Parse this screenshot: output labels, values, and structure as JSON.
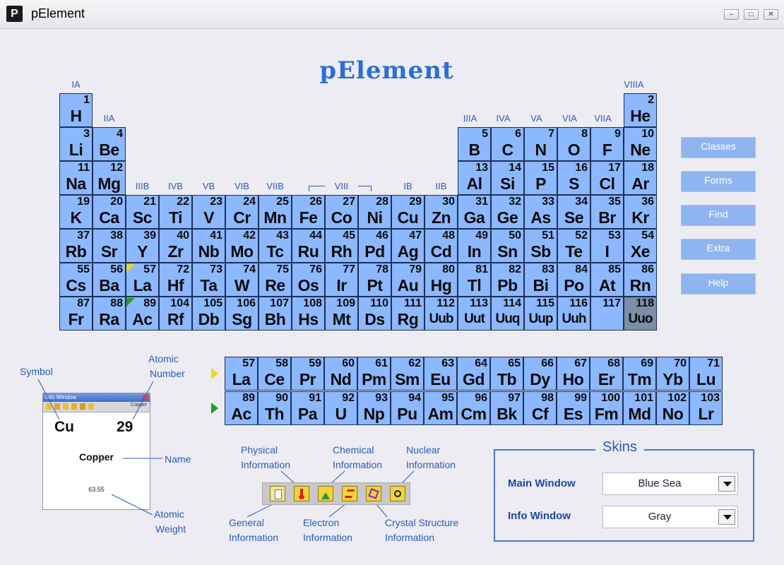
{
  "window": {
    "title": "pElement",
    "app_icon_letter": "P",
    "minimize_glyph": "–",
    "maximize_glyph": "□",
    "close_glyph": "✕"
  },
  "logo": "pElement",
  "group_labels": {
    "IA": "IA",
    "IIA": "IIA",
    "IIIA": "IIIA",
    "IVA": "IVA",
    "VA": "VA",
    "VIA": "VIA",
    "VIIA": "VIIA",
    "VIIIA": "VIIIA",
    "IIIB": "IIIB",
    "IVB": "IVB",
    "VB": "VB",
    "VIB": "VIB",
    "VIIB": "VIIB",
    "VIII": "VIII",
    "IB": "IB",
    "IIB": "IIB"
  },
  "elements": [
    {
      "n": "1",
      "s": "H",
      "r": 1,
      "c": 1
    },
    {
      "n": "2",
      "s": "He",
      "r": 1,
      "c": 18
    },
    {
      "n": "3",
      "s": "Li",
      "r": 2,
      "c": 1
    },
    {
      "n": "4",
      "s": "Be",
      "r": 2,
      "c": 2
    },
    {
      "n": "5",
      "s": "B",
      "r": 2,
      "c": 13
    },
    {
      "n": "6",
      "s": "C",
      "r": 2,
      "c": 14
    },
    {
      "n": "7",
      "s": "N",
      "r": 2,
      "c": 15
    },
    {
      "n": "8",
      "s": "O",
      "r": 2,
      "c": 16
    },
    {
      "n": "9",
      "s": "F",
      "r": 2,
      "c": 17
    },
    {
      "n": "10",
      "s": "Ne",
      "r": 2,
      "c": 18
    },
    {
      "n": "11",
      "s": "Na",
      "r": 3,
      "c": 1
    },
    {
      "n": "12",
      "s": "Mg",
      "r": 3,
      "c": 2
    },
    {
      "n": "13",
      "s": "Al",
      "r": 3,
      "c": 13
    },
    {
      "n": "14",
      "s": "Si",
      "r": 3,
      "c": 14
    },
    {
      "n": "15",
      "s": "P",
      "r": 3,
      "c": 15
    },
    {
      "n": "16",
      "s": "S",
      "r": 3,
      "c": 16
    },
    {
      "n": "17",
      "s": "Cl",
      "r": 3,
      "c": 17
    },
    {
      "n": "18",
      "s": "Ar",
      "r": 3,
      "c": 18
    },
    {
      "n": "19",
      "s": "K",
      "r": 4,
      "c": 1
    },
    {
      "n": "20",
      "s": "Ca",
      "r": 4,
      "c": 2
    },
    {
      "n": "21",
      "s": "Sc",
      "r": 4,
      "c": 3
    },
    {
      "n": "22",
      "s": "Ti",
      "r": 4,
      "c": 4
    },
    {
      "n": "23",
      "s": "V",
      "r": 4,
      "c": 5
    },
    {
      "n": "24",
      "s": "Cr",
      "r": 4,
      "c": 6
    },
    {
      "n": "25",
      "s": "Mn",
      "r": 4,
      "c": 7
    },
    {
      "n": "26",
      "s": "Fe",
      "r": 4,
      "c": 8
    },
    {
      "n": "27",
      "s": "Co",
      "r": 4,
      "c": 9
    },
    {
      "n": "28",
      "s": "Ni",
      "r": 4,
      "c": 10
    },
    {
      "n": "29",
      "s": "Cu",
      "r": 4,
      "c": 11
    },
    {
      "n": "30",
      "s": "Zn",
      "r": 4,
      "c": 12
    },
    {
      "n": "31",
      "s": "Ga",
      "r": 4,
      "c": 13
    },
    {
      "n": "32",
      "s": "Ge",
      "r": 4,
      "c": 14
    },
    {
      "n": "33",
      "s": "As",
      "r": 4,
      "c": 15
    },
    {
      "n": "34",
      "s": "Se",
      "r": 4,
      "c": 16
    },
    {
      "n": "35",
      "s": "Br",
      "r": 4,
      "c": 17
    },
    {
      "n": "36",
      "s": "Kr",
      "r": 4,
      "c": 18
    },
    {
      "n": "37",
      "s": "Rb",
      "r": 5,
      "c": 1
    },
    {
      "n": "38",
      "s": "Sr",
      "r": 5,
      "c": 2
    },
    {
      "n": "39",
      "s": "Y",
      "r": 5,
      "c": 3
    },
    {
      "n": "40",
      "s": "Zr",
      "r": 5,
      "c": 4
    },
    {
      "n": "41",
      "s": "Nb",
      "r": 5,
      "c": 5
    },
    {
      "n": "42",
      "s": "Mo",
      "r": 5,
      "c": 6
    },
    {
      "n": "43",
      "s": "Tc",
      "r": 5,
      "c": 7
    },
    {
      "n": "44",
      "s": "Ru",
      "r": 5,
      "c": 8
    },
    {
      "n": "45",
      "s": "Rh",
      "r": 5,
      "c": 9
    },
    {
      "n": "46",
      "s": "Pd",
      "r": 5,
      "c": 10
    },
    {
      "n": "47",
      "s": "Ag",
      "r": 5,
      "c": 11
    },
    {
      "n": "48",
      "s": "Cd",
      "r": 5,
      "c": 12
    },
    {
      "n": "49",
      "s": "In",
      "r": 5,
      "c": 13
    },
    {
      "n": "50",
      "s": "Sn",
      "r": 5,
      "c": 14
    },
    {
      "n": "51",
      "s": "Sb",
      "r": 5,
      "c": 15
    },
    {
      "n": "52",
      "s": "Te",
      "r": 5,
      "c": 16
    },
    {
      "n": "53",
      "s": "I",
      "r": 5,
      "c": 17
    },
    {
      "n": "54",
      "s": "Xe",
      "r": 5,
      "c": 18
    },
    {
      "n": "55",
      "s": "Cs",
      "r": 6,
      "c": 1
    },
    {
      "n": "56",
      "s": "Ba",
      "r": 6,
      "c": 2
    },
    {
      "n": "57",
      "s": "La",
      "r": 6,
      "c": 3
    },
    {
      "n": "72",
      "s": "Hf",
      "r": 6,
      "c": 4
    },
    {
      "n": "73",
      "s": "Ta",
      "r": 6,
      "c": 5
    },
    {
      "n": "74",
      "s": "W",
      "r": 6,
      "c": 6
    },
    {
      "n": "75",
      "s": "Re",
      "r": 6,
      "c": 7
    },
    {
      "n": "76",
      "s": "Os",
      "r": 6,
      "c": 8
    },
    {
      "n": "77",
      "s": "Ir",
      "r": 6,
      "c": 9
    },
    {
      "n": "78",
      "s": "Pt",
      "r": 6,
      "c": 10
    },
    {
      "n": "79",
      "s": "Au",
      "r": 6,
      "c": 11
    },
    {
      "n": "80",
      "s": "Hg",
      "r": 6,
      "c": 12
    },
    {
      "n": "81",
      "s": "Tl",
      "r": 6,
      "c": 13
    },
    {
      "n": "82",
      "s": "Pb",
      "r": 6,
      "c": 14
    },
    {
      "n": "83",
      "s": "Bi",
      "r": 6,
      "c": 15
    },
    {
      "n": "84",
      "s": "Po",
      "r": 6,
      "c": 16
    },
    {
      "n": "85",
      "s": "At",
      "r": 6,
      "c": 17
    },
    {
      "n": "86",
      "s": "Rn",
      "r": 6,
      "c": 18
    },
    {
      "n": "87",
      "s": "Fr",
      "r": 7,
      "c": 1
    },
    {
      "n": "88",
      "s": "Ra",
      "r": 7,
      "c": 2
    },
    {
      "n": "89",
      "s": "Ac",
      "r": 7,
      "c": 3
    },
    {
      "n": "104",
      "s": "Rf",
      "r": 7,
      "c": 4
    },
    {
      "n": "105",
      "s": "Db",
      "r": 7,
      "c": 5
    },
    {
      "n": "106",
      "s": "Sg",
      "r": 7,
      "c": 6
    },
    {
      "n": "107",
      "s": "Bh",
      "r": 7,
      "c": 7
    },
    {
      "n": "108",
      "s": "Hs",
      "r": 7,
      "c": 8
    },
    {
      "n": "109",
      "s": "Mt",
      "r": 7,
      "c": 9
    },
    {
      "n": "110",
      "s": "Ds",
      "r": 7,
      "c": 10
    },
    {
      "n": "111",
      "s": "Rg",
      "r": 7,
      "c": 11
    },
    {
      "n": "112",
      "s": "Uub",
      "r": 7,
      "c": 12
    },
    {
      "n": "113",
      "s": "Uut",
      "r": 7,
      "c": 13
    },
    {
      "n": "114",
      "s": "Uuq",
      "r": 7,
      "c": 14
    },
    {
      "n": "115",
      "s": "Uup",
      "r": 7,
      "c": 15
    },
    {
      "n": "116",
      "s": "Uuh",
      "r": 7,
      "c": 16
    },
    {
      "n": "117",
      "s": "",
      "r": 7,
      "c": 17
    },
    {
      "n": "118",
      "s": "Uuo",
      "r": 7,
      "c": 18,
      "dark": true
    }
  ],
  "lanthanides": [
    {
      "n": "57",
      "s": "La"
    },
    {
      "n": "58",
      "s": "Ce"
    },
    {
      "n": "59",
      "s": "Pr"
    },
    {
      "n": "60",
      "s": "Nd"
    },
    {
      "n": "61",
      "s": "Pm"
    },
    {
      "n": "62",
      "s": "Sm"
    },
    {
      "n": "63",
      "s": "Eu"
    },
    {
      "n": "64",
      "s": "Gd"
    },
    {
      "n": "65",
      "s": "Tb"
    },
    {
      "n": "66",
      "s": "Dy"
    },
    {
      "n": "67",
      "s": "Ho"
    },
    {
      "n": "68",
      "s": "Er"
    },
    {
      "n": "69",
      "s": "Tm"
    },
    {
      "n": "70",
      "s": "Yb"
    },
    {
      "n": "71",
      "s": "Lu"
    }
  ],
  "actinides": [
    {
      "n": "89",
      "s": "Ac"
    },
    {
      "n": "90",
      "s": "Th"
    },
    {
      "n": "91",
      "s": "Pa"
    },
    {
      "n": "92",
      "s": "U"
    },
    {
      "n": "93",
      "s": "Np"
    },
    {
      "n": "94",
      "s": "Pu"
    },
    {
      "n": "95",
      "s": "Am"
    },
    {
      "n": "96",
      "s": "Cm"
    },
    {
      "n": "97",
      "s": "Bk"
    },
    {
      "n": "98",
      "s": "Cf"
    },
    {
      "n": "99",
      "s": "Es"
    },
    {
      "n": "100",
      "s": "Fm"
    },
    {
      "n": "101",
      "s": "Md"
    },
    {
      "n": "102",
      "s": "No"
    },
    {
      "n": "103",
      "s": "Lr"
    }
  ],
  "side_buttons": [
    "Classes",
    "Forms",
    "Find",
    "Extra",
    "Help"
  ],
  "legend": {
    "symbol": "Symbol",
    "atomic_number": [
      "Atomic",
      "Number"
    ],
    "name": "Name",
    "atomic_weight": [
      "Atomic",
      "Weight"
    ]
  },
  "info_preview": {
    "title": "Info Window",
    "element_tag": "Copper",
    "symbol": "Cu",
    "number": "29",
    "name": "Copper",
    "weight": "63.55"
  },
  "toolbar_labels": {
    "physical": [
      "Physical",
      "Information"
    ],
    "chemical": [
      "Chemical",
      "Information"
    ],
    "nuclear": [
      "Nuclear",
      "Information"
    ],
    "general": [
      "General",
      "Information"
    ],
    "electron": [
      "Electron",
      "Information"
    ],
    "crystal": [
      "Crystal Structure",
      "Information"
    ]
  },
  "skins": {
    "title": "Skins",
    "main_window_label": "Main Window",
    "main_window_value": "Blue Sea",
    "info_window_label": "Info Window",
    "info_window_value": "Gray"
  },
  "colors": {
    "cell": "#8CB8FF",
    "accent": "#2a6fd6",
    "label": "#2a5ac0"
  }
}
